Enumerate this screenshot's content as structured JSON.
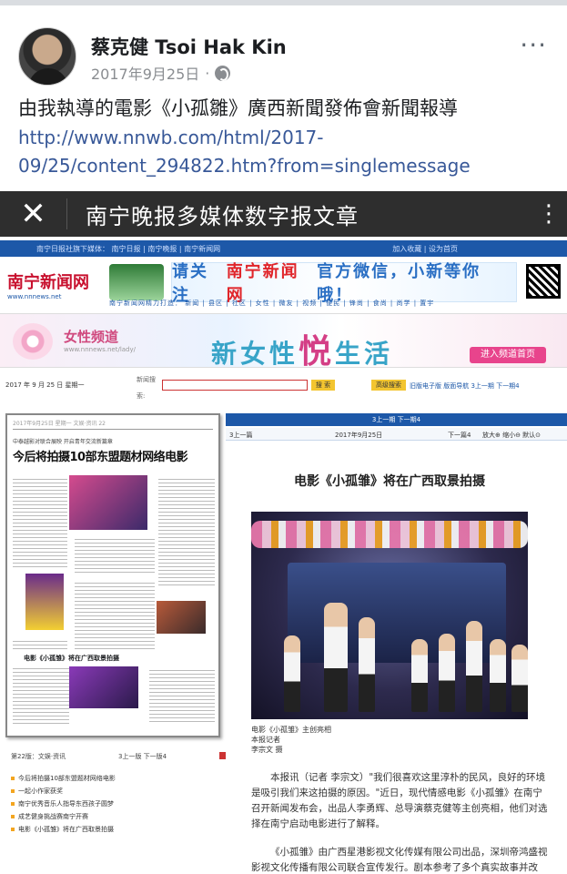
{
  "post": {
    "author": "蔡克健 Tsoi Hak Kin",
    "date": "2017年9月25日",
    "dot": "·",
    "more": "···",
    "text": "由我執導的電影《小孤雛》廣西新聞發佈會新聞報導",
    "link": "http://www.nnwb.com/html/2017-09/25/content_294822.htm?from=singlemessage"
  },
  "wechat": {
    "close": "✕",
    "title": "南宁晚报多媒体数字报文章",
    "dots": "⋮"
  },
  "site": {
    "topline_left": "南宁日报社旗下媒体： 南宁日报 | 南宁晚报 | 南宁新闻网",
    "topline_right": "加入收藏 | 设为首页",
    "logo": "南宁新闻网",
    "logo_url": "www.nnnews.net",
    "ad_text_1": "请关注",
    "ad_text_red": "南宁新闻网",
    "ad_text_2": "官方微信，小新等你哦！",
    "nav": "南宁新闻网精力打造： 新闻 | 县区 | 社区 | 女性 | 微友 | 视频 | 便民 | 锋尚 | 食尚 | 尚学 | 置宇",
    "women_channel": "女性频道",
    "women_url": "www.nnnews.net/lady/",
    "slogan_1": "新女性",
    "slogan_big": "悦",
    "slogan_2": "生活",
    "women_btn": "进入频道首页",
    "date": "2017 年 9 月 25 日  星期一",
    "search_label": "新闻搜",
    "search_btn": "搜 索",
    "advanced_btn": "高级搜索",
    "links": "旧版电子版  版面导航  3上一期  下一期4",
    "col_label": "索:"
  },
  "paper": {
    "head": "2017年9月25日 星期一  文娱·资讯  22",
    "sub": "中泰越影对联合展映 开启青年交流新篇章",
    "title": "今后将拍摄10部东盟题材网络电影",
    "bold_item": "电影《小孤雏》将在广西取景拍摄",
    "page_label": "第22版：文娱·资讯",
    "page_nav": "3上一版  下一版4",
    "toc": [
      "今后将拍摄10部东盟题材网络电影",
      "一起小作家获奖",
      "南宁优秀音乐人指导东西孩子圆梦",
      "成艺健身挑战赛南宁开赛",
      "电影《小孤雏》将在广西取景拍摄"
    ]
  },
  "article": {
    "bar": "3上一期  下一期4",
    "prev": "3上一篇",
    "date": "2017年9月25日",
    "next": "下一篇4",
    "zoom": "放大⊕ 缩小⊖ 默认⊙",
    "title": "电影《小孤雏》将在广西取景拍摄",
    "caption": [
      "电影《小孤雏》主创亮相",
      "本报记者",
      "李宗文 摄"
    ],
    "para1": "本报讯（记者 李宗文）\"我们很喜欢这里淳朴的民风，良好的环境是吸引我们来这拍摄的原因。\"近日，现代情感电影《小孤雏》在南宁召开新闻发布会，出品人李勇辉、总导演蔡克健等主创亮相，他们对选择在南宁启动电影进行了解释。",
    "para2": "《小孤雏》由广西星港影视文化传媒有限公司出品，深圳帝鸿盛视影视文化传播有限公司联合宣传发行。剧本参考了多个真实故事并改编，由杨泽怡担任编剧。"
  }
}
